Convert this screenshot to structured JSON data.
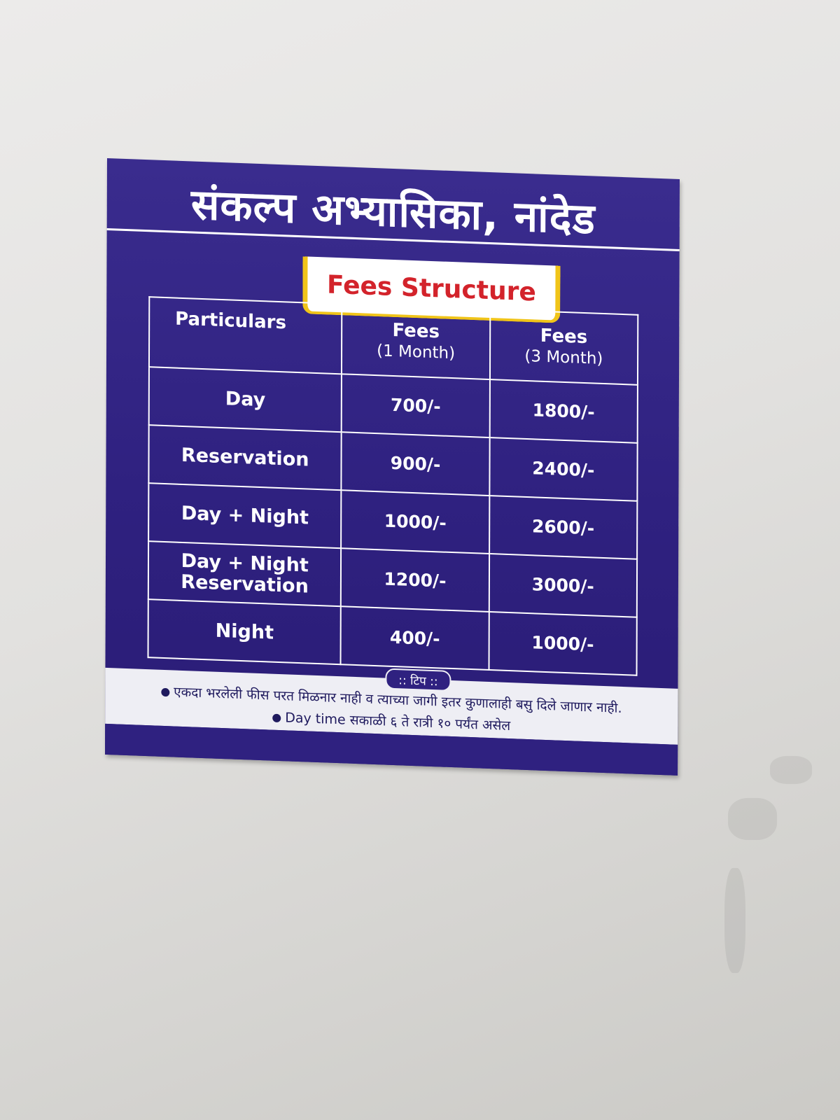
{
  "sign": {
    "title": "संकल्प अभ्यासिका, नांदेड",
    "banner": "Fees Structure",
    "table": {
      "headers": {
        "particulars": "Particulars",
        "one_month_title": "Fees",
        "one_month_sub": "(1 Month)",
        "three_month_title": "Fees",
        "three_month_sub": "(3 Month)"
      },
      "rows": [
        {
          "label": "Day",
          "one_month": "700/-",
          "three_month": "1800/-"
        },
        {
          "label": "Reservation",
          "one_month": "900/-",
          "three_month": "2400/-"
        },
        {
          "label": "Day + Night",
          "one_month": "1000/-",
          "three_month": "2600/-"
        },
        {
          "label_line1": "Day + Night",
          "label_line2": "Reservation",
          "one_month": "1200/-",
          "three_month": "3000/-"
        },
        {
          "label": "Night",
          "one_month": "400/-",
          "three_month": "1000/-"
        }
      ]
    },
    "tip_label": ":: टिप ::",
    "notes": [
      "एकदा भरलेली फीस परत मिळनार नाही व त्याच्या जागी इतर कुणालाही बसु दिले जाणार नाही.",
      "Day time सकाळी ६ ते रात्री १० पर्यंत असेल"
    ]
  },
  "colors": {
    "board": "#2f2180",
    "banner_text": "#d3232b",
    "banner_border": "#f0c419",
    "wall": "#e2e1df"
  }
}
